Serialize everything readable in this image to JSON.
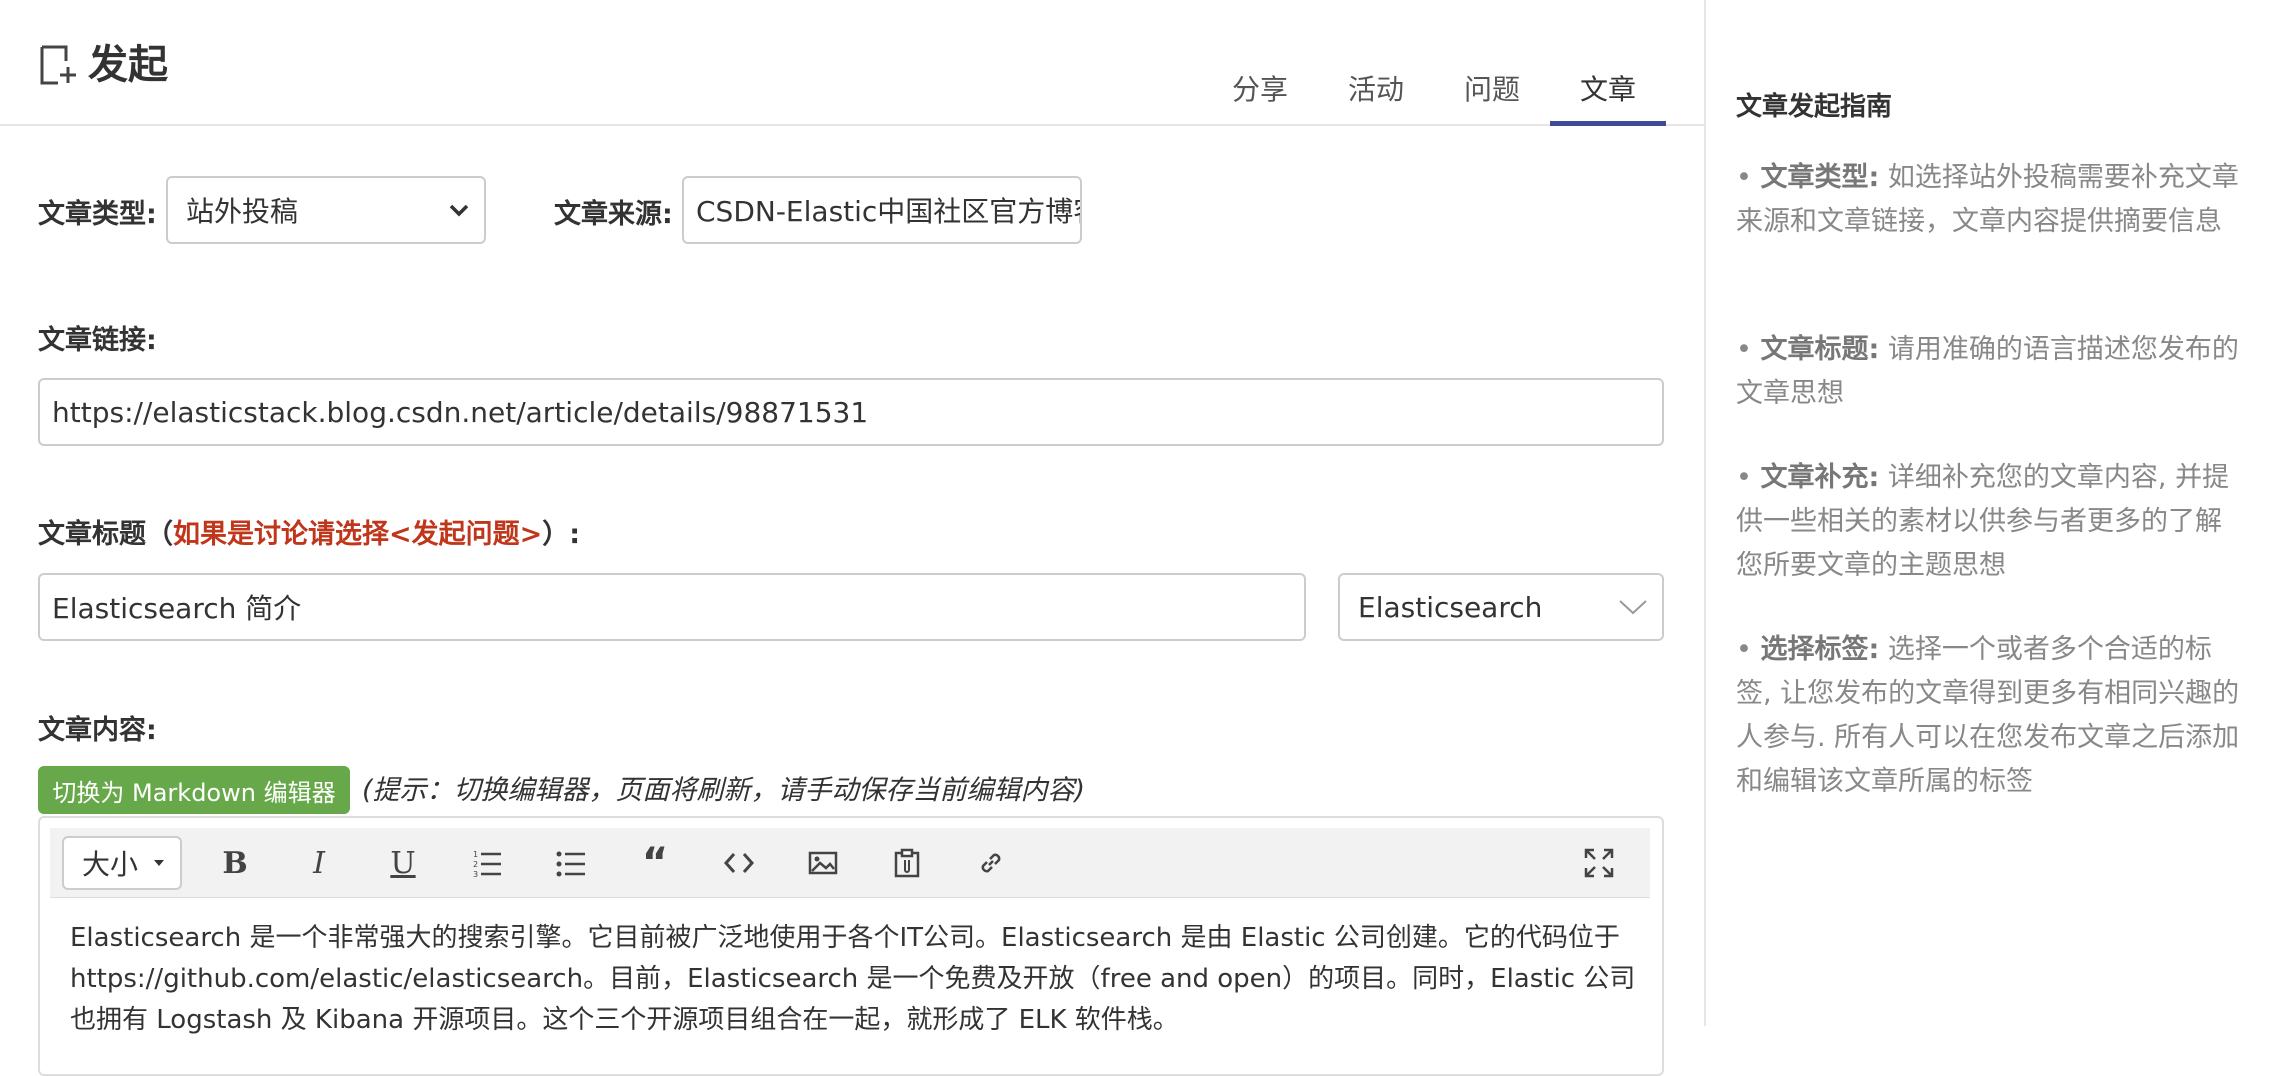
{
  "header": {
    "title": "发起",
    "tabs": [
      {
        "label": "分享",
        "active": false
      },
      {
        "label": "活动",
        "active": false
      },
      {
        "label": "问题",
        "active": false
      },
      {
        "label": "文章",
        "active": true
      }
    ],
    "accent_color": "#3f4a9c"
  },
  "form": {
    "type_label": "文章类型:",
    "type_value": "站外投稿",
    "source_label": "文章来源:",
    "source_value": "CSDN-Elastic中国社区官方博客",
    "link_label": "文章链接:",
    "link_value": "https://elasticstack.blog.csdn.net/article/details/98871531",
    "title_label_pre": "文章标题（",
    "title_label_hint": "如果是讨论请选择<发起问题>",
    "title_label_post": "）:",
    "title_value": "Elasticsearch 简介",
    "category_value": "Elasticsearch",
    "content_label": "文章内容:",
    "markdown_button": "切换为 Markdown 编辑器",
    "tip": "(提示：切换编辑器，页面将刷新，请手动保存当前编辑内容)"
  },
  "editor": {
    "size_label": "大小",
    "tools": [
      "bold-icon",
      "italic-icon",
      "underline-icon",
      "ordered-list-icon",
      "unordered-list-icon",
      "quote-icon",
      "code-icon",
      "image-icon",
      "attachment-icon",
      "link-icon",
      "fullscreen-icon"
    ],
    "content": "Elasticsearch 是一个非常强大的搜索引擎。它目前被广泛地使用于各个IT公司。Elasticsearch 是由 Elastic 公司创建。它的代码位于 https://github.com/elastic/elasticsearch。目前，Elasticsearch 是一个免费及开放（free and open）的项目。同时，Elastic 公司也拥有 Logstash 及 Kibana 开源项目。这个三个开源项目组合在一起，就形成了 ELK 软件栈。"
  },
  "sidebar": {
    "title": "文章发起指南",
    "guides": [
      {
        "term": "文章类型:",
        "text": " 如选择站外投稿需要补充文章来源和文章链接，文章内容提供摘要信息"
      },
      {
        "term": "文章标题:",
        "text": " 请用准确的语言描述您发布的文章思想"
      },
      {
        "term": "文章补充:",
        "text": " 详细补充您的文章内容, 并提供一些相关的素材以供参与者更多的了解您所要文章的主题思想"
      },
      {
        "term": "选择标签:",
        "text": " 选择一个或者多个合适的标签, 让您发布的文章得到更多有相同兴趣的人参与. 所有人可以在您发布文章之后添加和编辑该文章所属的标签"
      }
    ]
  }
}
